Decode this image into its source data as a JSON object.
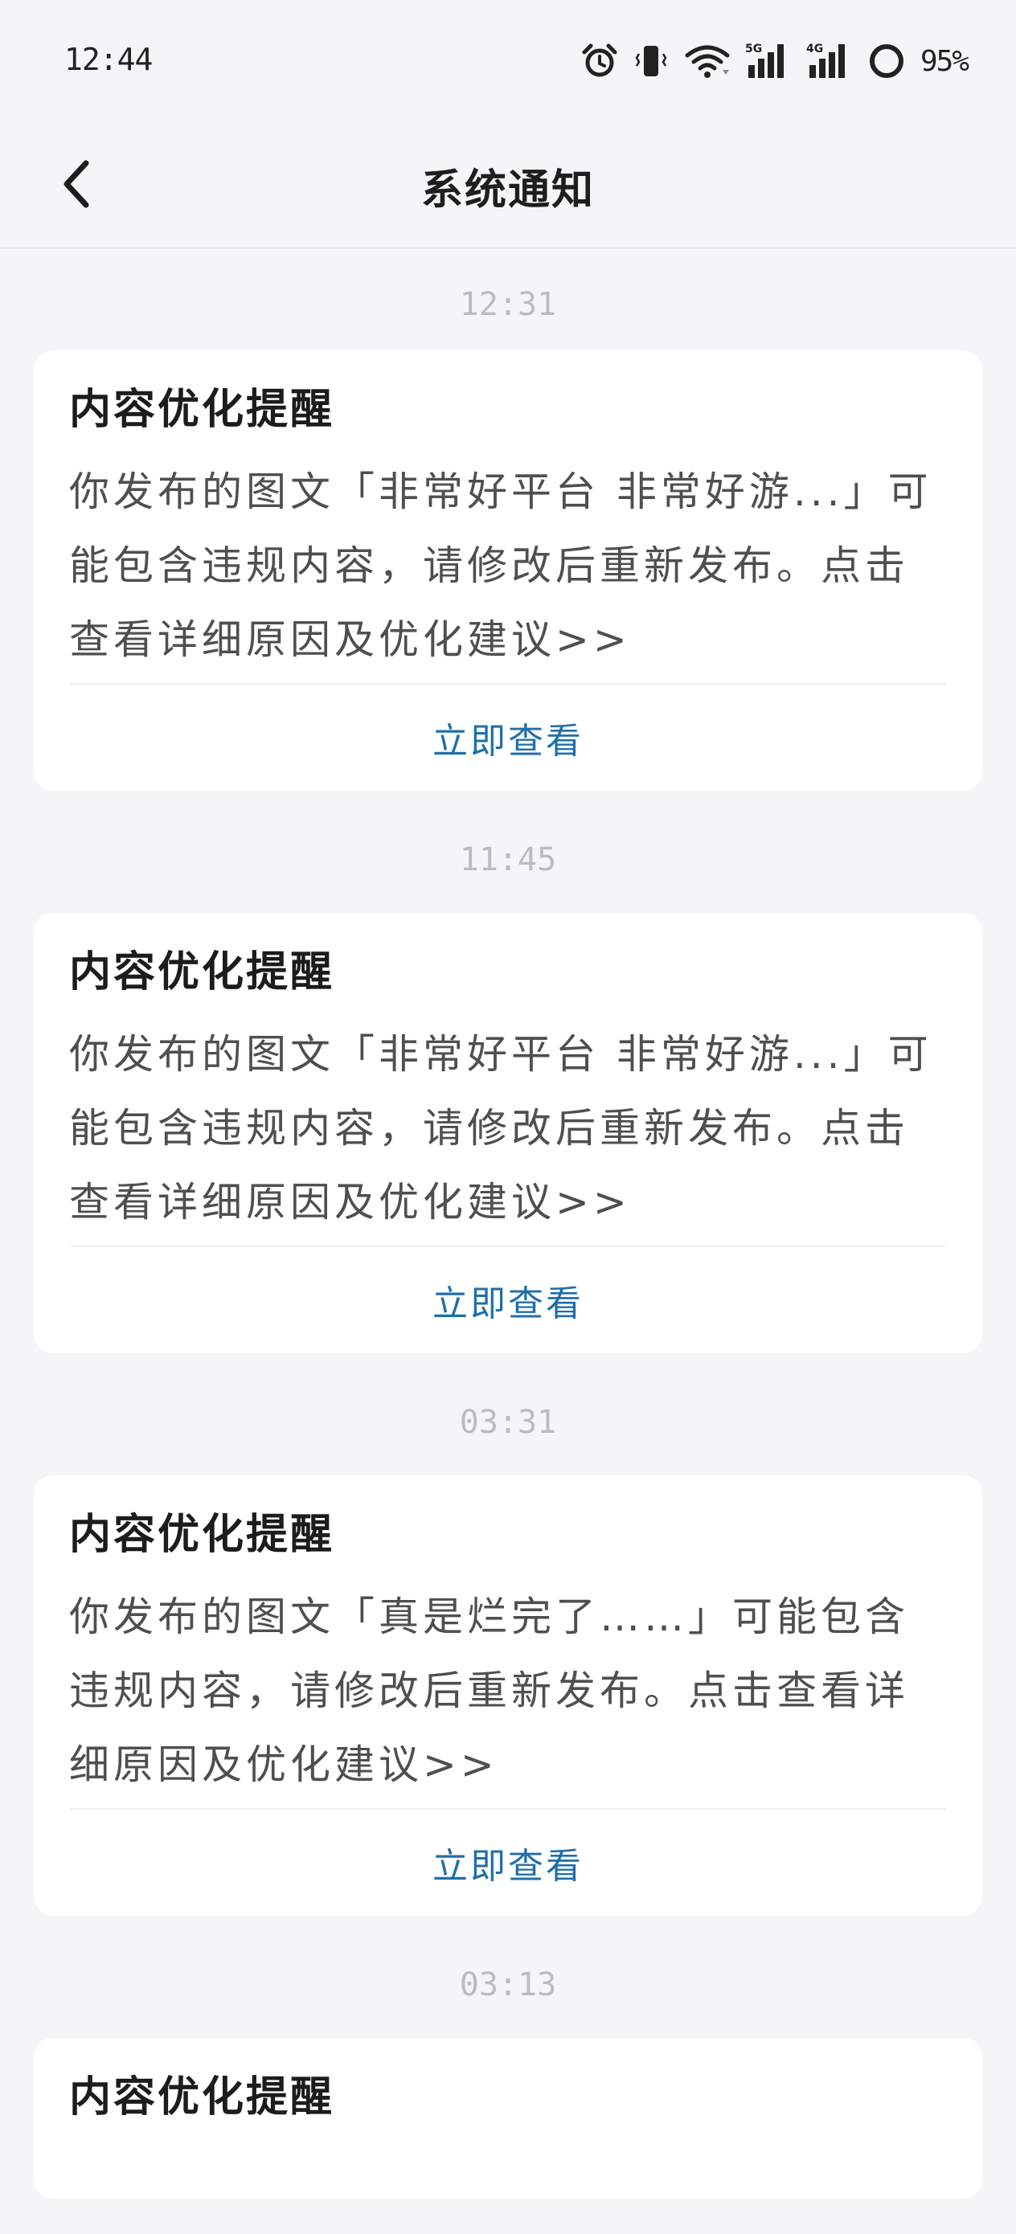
{
  "status_bar": {
    "time": "12:44",
    "battery_percent": "95%",
    "icons": [
      "alarm-icon",
      "vibrate-icon",
      "wifi-icon",
      "signal-5g-icon",
      "signal-4g-icon",
      "battery-ring-icon"
    ],
    "network_labels": {
      "first": "5G",
      "second": "4G"
    }
  },
  "nav": {
    "title": "系统通知",
    "back_icon": "chevron-left-icon"
  },
  "notifications": [
    {
      "time": "12:31",
      "title": "内容优化提醒",
      "body": "你发布的图文「非常好平台 非常好游...」可能包含违规内容，请修改后重新发布。点击查看详细原因及优化建议>>",
      "action": "立即查看"
    },
    {
      "time": "11:45",
      "title": "内容优化提醒",
      "body": "你发布的图文「非常好平台 非常好游...」可能包含违规内容，请修改后重新发布。点击查看详细原因及优化建议>>",
      "action": "立即查看"
    },
    {
      "time": "03:31",
      "title": "内容优化提醒",
      "body": "你发布的图文「真是烂完了……」可能包含违规内容，请修改后重新发布。点击查看详细原因及优化建议>>",
      "action": "立即查看"
    },
    {
      "time": "03:13",
      "title": "内容优化提醒"
    }
  ],
  "colors": {
    "background": "#f4f5f7",
    "card": "#ffffff",
    "action_link": "#1f6fa8",
    "timestamp": "#b8bcc3"
  }
}
